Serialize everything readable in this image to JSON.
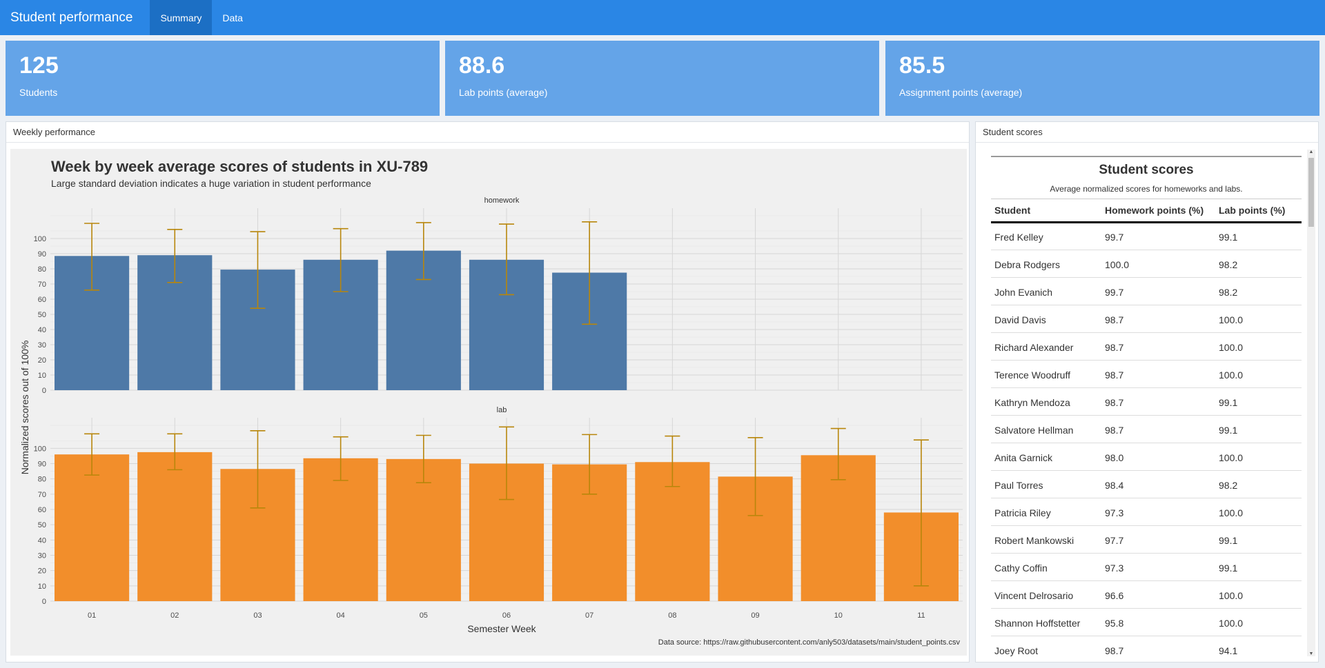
{
  "navbar": {
    "brand": "Student performance",
    "tabs": [
      {
        "label": "Summary",
        "active": true
      },
      {
        "label": "Data",
        "active": false
      }
    ]
  },
  "value_boxes": [
    {
      "value": "125",
      "label": "Students"
    },
    {
      "value": "88.6",
      "label": "Lab points (average)"
    },
    {
      "value": "85.5",
      "label": "Assignment points (average)"
    }
  ],
  "weekly_card": {
    "title": "Weekly performance"
  },
  "scores_card": {
    "title": "Student scores"
  },
  "colors": {
    "navbar": "#2a86e5",
    "active_tab": "#1c6fc4",
    "value_box": "#64a4e8",
    "homework_bar": "#4e79a7",
    "lab_bar": "#f28e2b",
    "error_bar": "#b8860b"
  },
  "chart_data": {
    "type": "bar",
    "title": "Week by week average scores of students in XU-789",
    "subtitle": "Large standard deviation indicates a huge variation in student performance",
    "xlabel": "Semester Week",
    "ylabel": "Normalized scores out of 100%",
    "caption": "Data source: https://raw.githubusercontent.com/anly503/datasets/main/student_points.csv",
    "categories": [
      "01",
      "02",
      "03",
      "04",
      "05",
      "06",
      "07",
      "08",
      "09",
      "10",
      "11"
    ],
    "ylim": [
      0,
      100
    ],
    "yticks": [
      0,
      10,
      20,
      30,
      40,
      50,
      60,
      70,
      80,
      90,
      100
    ],
    "facets": [
      {
        "name": "homework",
        "values": [
          88.5,
          89,
          79.5,
          86,
          92,
          86,
          77.5,
          null,
          null,
          null,
          null
        ],
        "err_low": [
          66,
          71,
          54,
          65,
          73,
          63,
          43.5,
          null,
          null,
          null,
          null
        ],
        "err_high": [
          110,
          106,
          104.5,
          106.5,
          110.5,
          109.5,
          111,
          null,
          null,
          null,
          null
        ]
      },
      {
        "name": "lab",
        "values": [
          96,
          97.5,
          86.5,
          93.5,
          93,
          90,
          89.5,
          91,
          81.5,
          95.5,
          58
        ],
        "err_low": [
          82.5,
          86,
          61,
          79,
          77.5,
          66.5,
          70,
          75,
          56,
          79.5,
          10
        ],
        "err_high": [
          109.5,
          109.5,
          111.5,
          107.5,
          108.5,
          114,
          109,
          108,
          107,
          113,
          105.5
        ]
      }
    ]
  },
  "scores_table": {
    "title": "Student scores",
    "subtitle": "Average normalized scores for homeworks and labs.",
    "headers": [
      "Student",
      "Homework points (%)",
      "Lab points (%)"
    ],
    "rows": [
      [
        "Fred Kelley",
        "99.7",
        "99.1"
      ],
      [
        "Debra Rodgers",
        "100.0",
        "98.2"
      ],
      [
        "John Evanich",
        "99.7",
        "98.2"
      ],
      [
        "David Davis",
        "98.7",
        "100.0"
      ],
      [
        "Richard Alexander",
        "98.7",
        "100.0"
      ],
      [
        "Terence Woodruff",
        "98.7",
        "100.0"
      ],
      [
        "Kathryn Mendoza",
        "98.7",
        "99.1"
      ],
      [
        "Salvatore Hellman",
        "98.7",
        "99.1"
      ],
      [
        "Anita Garnick",
        "98.0",
        "100.0"
      ],
      [
        "Paul Torres",
        "98.4",
        "98.2"
      ],
      [
        "Patricia Riley",
        "97.3",
        "100.0"
      ],
      [
        "Robert Mankowski",
        "97.7",
        "99.1"
      ],
      [
        "Cathy Coffin",
        "97.3",
        "99.1"
      ],
      [
        "Vincent Delrosario",
        "96.6",
        "100.0"
      ],
      [
        "Shannon Hoffstetter",
        "95.8",
        "100.0"
      ],
      [
        "Joey Root",
        "98.7",
        "94.1"
      ]
    ]
  }
}
